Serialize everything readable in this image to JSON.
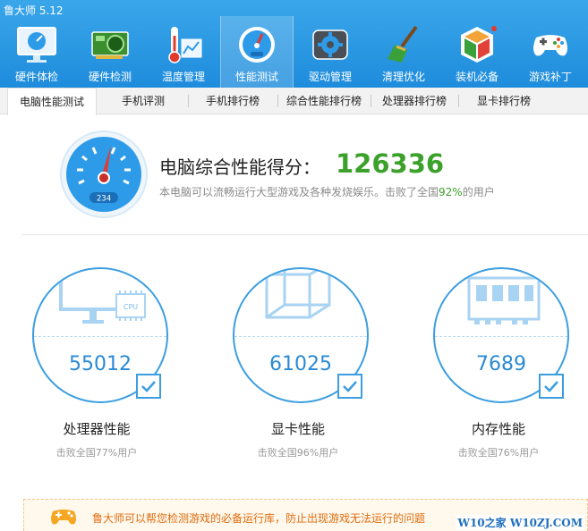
{
  "app": {
    "title": "鲁大师 5.12"
  },
  "nav": [
    {
      "label": "硬件体检",
      "icon": "monitor-clock-icon"
    },
    {
      "label": "硬件检测",
      "icon": "graphics-card-icon"
    },
    {
      "label": "温度管理",
      "icon": "thermometer-icon"
    },
    {
      "label": "性能测试",
      "icon": "speedometer-icon",
      "active": true
    },
    {
      "label": "驱动管理",
      "icon": "gear-box-icon"
    },
    {
      "label": "清理优化",
      "icon": "broom-icon"
    },
    {
      "label": "装机必备",
      "icon": "cube-box-icon"
    },
    {
      "label": "游戏补丁",
      "icon": "gamepad-icon"
    }
  ],
  "subtabs": [
    "电脑性能测试",
    "手机评测",
    "手机排行榜",
    "综合性能排行榜",
    "处理器排行榜",
    "显卡排行榜"
  ],
  "score": {
    "title": "电脑综合性能得分：",
    "value": "126336",
    "gauge_readout": "234",
    "desc_prefix": "本电脑可以流畅运行大型游戏及各种发烧娱乐。击败了全国",
    "desc_pct": "92%",
    "desc_suffix": "的用户"
  },
  "components": [
    {
      "name": "处理器性能",
      "value": "55012",
      "sub": "击败全国77%用户",
      "icon": "cpu-monitor-icon",
      "chip_text": "CPU"
    },
    {
      "name": "显卡性能",
      "value": "61025",
      "sub": "击败全国96%用户",
      "icon": "graphics-cube-icon"
    },
    {
      "name": "内存性能",
      "value": "7689",
      "sub": "击败全国76%用户",
      "icon": "memory-chip-icon"
    }
  ],
  "banner": {
    "text": "鲁大师可以帮您检测游戏的必备运行库，防止出现游戏无法运行的问题"
  },
  "watermark": "W10之家 W10ZJ.COM",
  "colors": {
    "accent": "#1e8cdc",
    "score_green": "#3ca12b",
    "banner_text": "#e06c0f"
  }
}
